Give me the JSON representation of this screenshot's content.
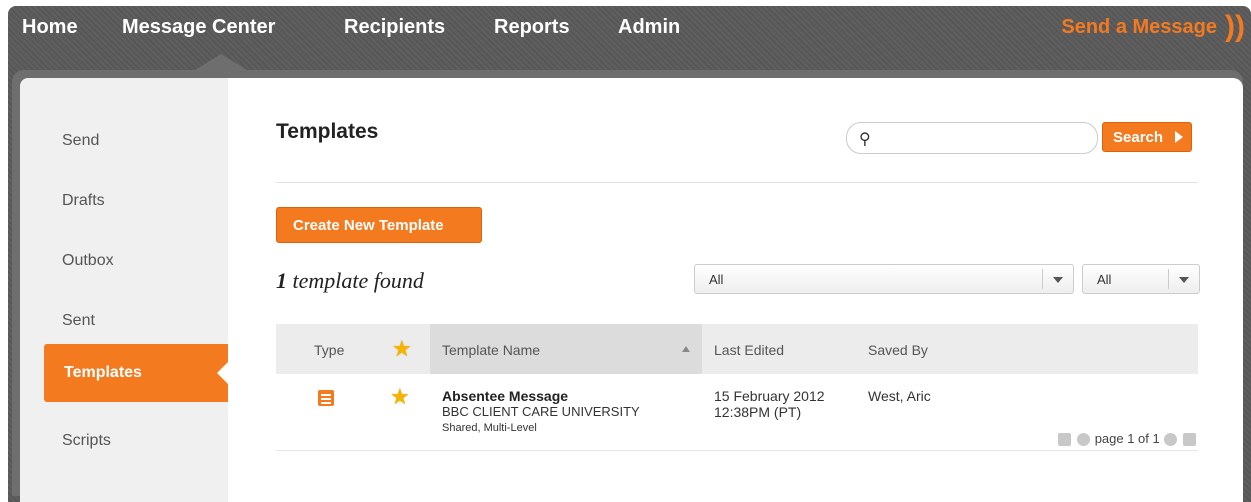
{
  "nav": {
    "items": [
      "Home",
      "Message Center",
      "Recipients",
      "Reports",
      "Admin"
    ],
    "send_message": "Send a Message",
    "send_icon": "))"
  },
  "sidebar": {
    "items": [
      "Send",
      "Drafts",
      "Outbox",
      "Sent",
      "Templates",
      "Scripts"
    ],
    "active": "Templates"
  },
  "main": {
    "title": "Templates",
    "search": {
      "placeholder": "",
      "button": "Search"
    },
    "create_button": "Create New Template",
    "count_number": "1",
    "count_text": "template found",
    "filters": [
      "All",
      "All"
    ]
  },
  "table": {
    "headers": [
      "Type",
      "Template Name",
      "Last Edited",
      "Saved By"
    ],
    "rows": [
      {
        "name": "Absentee Message",
        "org": "BBC CLIENT CARE UNIVERSITY",
        "shared": "Shared, Multi-Level",
        "date": "15 February 2012",
        "time": "12:38PM (PT)",
        "saved_by": "West, Aric"
      }
    ]
  },
  "pager": {
    "text": "page 1 of 1"
  },
  "colors": {
    "accent": "#f47a20",
    "star": "#f5b400",
    "nav_bg": "#5a5a5a"
  }
}
